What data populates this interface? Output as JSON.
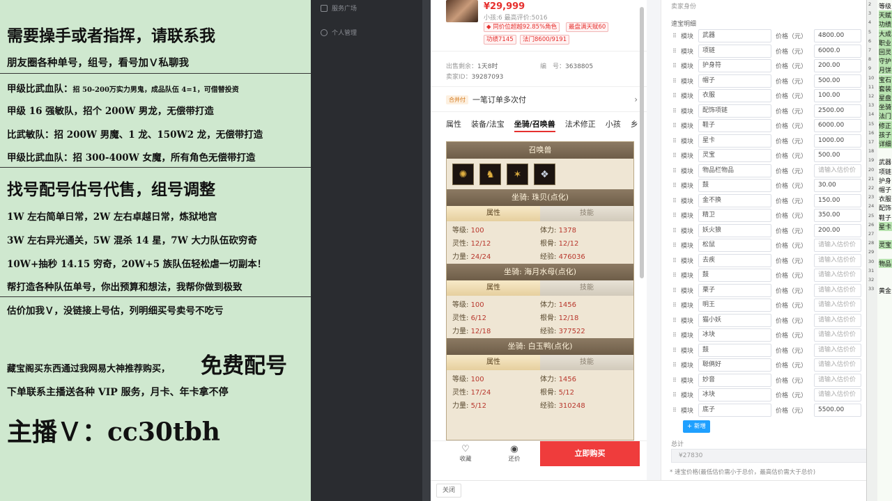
{
  "promo": {
    "lines": [
      "需要操手或者指挥，请联系我",
      "朋友圈各种单号，组号，看号加Ｖ私聊我",
      "甲级比武血队：",
      "招 50-200万实力男鬼，成品队伍 4=1，可借替投资",
      "甲级 16 强敏队，招个 200W 男龙，无偿带打造",
      "比武敏队：招 200W 男魔、1 龙、150W2 龙，无偿带打造",
      "甲级比武血队：招 300-400W 女魔，所有角色无偿带打造",
      "找号配号估号代售，组号调整",
      "1W 左右简单日常，2W 左右卓越日常，炼狱地宫",
      "3W 左右异光通关，5W 混杀 14 星，7W 大力队伍砍穷奇",
      "10W+抽秒 14.15 穷奇，20W+5 族队伍轻松虐一切副本！",
      "帮打造各种队伍单号，你出预算和想法，我帮你做到极致",
      "估价加我Ｖ，没链接上号估，列明细买号卖号不吃亏",
      "藏宝阁买东西通过我网易大神推荐购买，",
      "免费配号",
      "下单联系主播送各种 VIP 服务，月卡、年卡拿不停",
      "主播Ｖ：cc30tbh"
    ]
  },
  "sidebar": {
    "items": [
      "服务广场",
      "个人管理"
    ]
  },
  "product": {
    "price": "¥29,999",
    "subline": "小孩:6 最高评价:5016",
    "tags": [
      "◆ 同价位超越92.85%角色",
      "最盘满天赋60",
      "功绩7145",
      "法门8600/9191"
    ],
    "meta": {
      "remain_label": "出售剩余：",
      "remain_value": "1天8时",
      "id_label": "编　号：",
      "id_value": "3638805",
      "seller_label": "卖家ID：",
      "seller_value": "39287093"
    },
    "payment": {
      "badge": "合并付",
      "text": "一笔订单多次付",
      "chevron": "›"
    },
    "tabs": [
      "属性",
      "装备/法宝",
      "坐骑/召唤兽",
      "法术修正",
      "小孩",
      "乡"
    ],
    "actions": {
      "collect": "收藏",
      "counter": "还价",
      "buy": "立即购买"
    },
    "close": "关闭"
  },
  "game": {
    "header": "召唤兽",
    "pet_icons": [
      "fire-sprite-icon",
      "golden-beast-icon",
      "dragon-icon",
      "wolf-icon"
    ],
    "subtab_attr": "属性",
    "subtab_skill": "技能",
    "mounts": [
      {
        "name": "坐骑: 珠贝(点化)",
        "stats": [
          [
            "等级:",
            "100",
            "体力:",
            "1378"
          ],
          [
            "灵性:",
            "12/12",
            "根骨:",
            "12/12"
          ],
          [
            "力量:",
            "24/24",
            "经验:",
            "476036"
          ]
        ]
      },
      {
        "name": "坐骑: 海月水母(点化)",
        "stats": [
          [
            "等级:",
            "100",
            "体力:",
            "1456"
          ],
          [
            "灵性:",
            "6/12",
            "根骨:",
            "12/18"
          ],
          [
            "力量:",
            "12/18",
            "经验:",
            "377522"
          ]
        ]
      },
      {
        "name": "坐骑: 白玉鸭(点化)",
        "stats": [
          [
            "等级:",
            "100",
            "体力:",
            "1456"
          ],
          [
            "灵性:",
            "17/24",
            "根骨:",
            "5/12"
          ],
          [
            "力量:",
            "5/12",
            "经验:",
            "310248"
          ]
        ]
      }
    ]
  },
  "form": {
    "title": "卖家身份",
    "section": "速宝明细",
    "module_label": "模块",
    "price_label": "价格（元）",
    "placeholder": "请输入估价价",
    "rows": [
      {
        "name": "武器",
        "price": "4800.00"
      },
      {
        "name": "项链",
        "price": "6000.0"
      },
      {
        "name": "护身符",
        "price": "200.00"
      },
      {
        "name": "帽子",
        "price": "500.00"
      },
      {
        "name": "衣服",
        "price": "100.00"
      },
      {
        "name": "配饰项链",
        "price": "2500.00"
      },
      {
        "name": "鞋子",
        "price": "6000.00"
      },
      {
        "name": "星卡",
        "price": "1000.00"
      },
      {
        "name": "灵宝",
        "price": "500.00"
      },
      {
        "name": "物品栏物品",
        "price": ""
      },
      {
        "name": "鼓",
        "price": "30.00"
      },
      {
        "name": "金不换",
        "price": "150.00"
      },
      {
        "name": "精卫",
        "price": "350.00"
      },
      {
        "name": "妖火狼",
        "price": "200.00"
      },
      {
        "name": "松鼠",
        "price": ""
      },
      {
        "name": "去疾",
        "price": ""
      },
      {
        "name": "鼓",
        "price": ""
      },
      {
        "name": "栗子",
        "price": ""
      },
      {
        "name": "明王",
        "price": ""
      },
      {
        "name": "猫小妖",
        "price": ""
      },
      {
        "name": "冰块",
        "price": ""
      },
      {
        "name": "鼓",
        "price": ""
      },
      {
        "name": "聪俩好",
        "price": ""
      },
      {
        "name": "妙音",
        "price": ""
      },
      {
        "name": "冰块",
        "price": ""
      },
      {
        "name": "底子",
        "price": "5500.00"
      }
    ],
    "add_button": "+ 新增",
    "total_label": "总计",
    "total_value": "¥27830",
    "note": "* 速宝价格(最低估价需小于总价，最高估价需大于总价)"
  },
  "sheet": {
    "rows": [
      "等级",
      "天赋",
      "功绩",
      "大成",
      "职业",
      "回灵",
      "守护",
      "月饼",
      "宝石",
      "套装",
      "星盘",
      "坐骑",
      "法门",
      "修正",
      "孩子",
      "详细",
      "",
      "武器",
      "项链",
      "护身",
      "帽子",
      "衣服",
      "配饰",
      "鞋子",
      "星卡",
      "",
      "灵宝",
      "",
      "物品",
      "",
      "",
      "黄金"
    ],
    "row_numbers": [
      "2",
      "3",
      "4",
      "5",
      "6",
      "7",
      "8",
      "9",
      "10",
      "11",
      "12",
      "13",
      "14",
      "15",
      "16",
      "17",
      "18",
      "19",
      "20",
      "21",
      "22",
      "23",
      "24",
      "25",
      "26",
      "27",
      "28",
      "29",
      "30",
      "31",
      "32",
      "33"
    ]
  }
}
